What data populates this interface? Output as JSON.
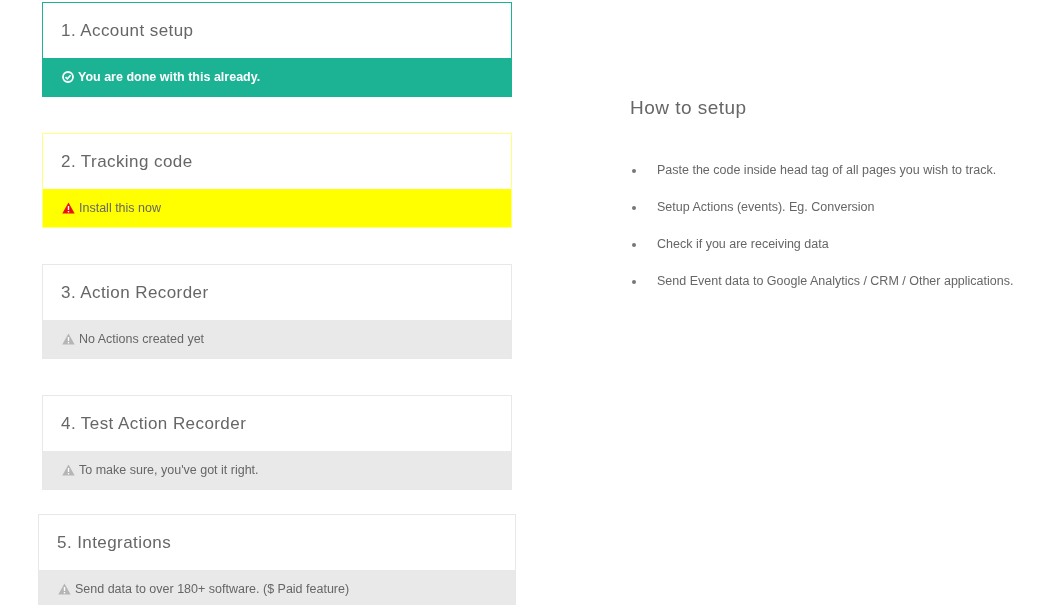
{
  "steps": [
    {
      "title": "1. Account setup",
      "kind": "done",
      "message": "You are done with this already."
    },
    {
      "title": "2. Tracking code",
      "kind": "pending",
      "message": "Install this now"
    },
    {
      "title": "3. Action Recorder",
      "kind": "locked",
      "message": "No Actions created yet"
    },
    {
      "title": "4. Test Action Recorder",
      "kind": "locked",
      "message": "To make sure, you've got it right."
    },
    {
      "title": "5. Integrations",
      "kind": "locked",
      "message": "Send data to over 180+ software. ($ Paid feature)"
    }
  ],
  "how_to": {
    "title": "How to setup",
    "items": [
      "Paste the code inside head tag of all pages you wish to track.",
      "Setup Actions (events). Eg. Conversion",
      "Check if you are receiving data",
      "Send Event data to Google Analytics / CRM / Other applications."
    ]
  }
}
